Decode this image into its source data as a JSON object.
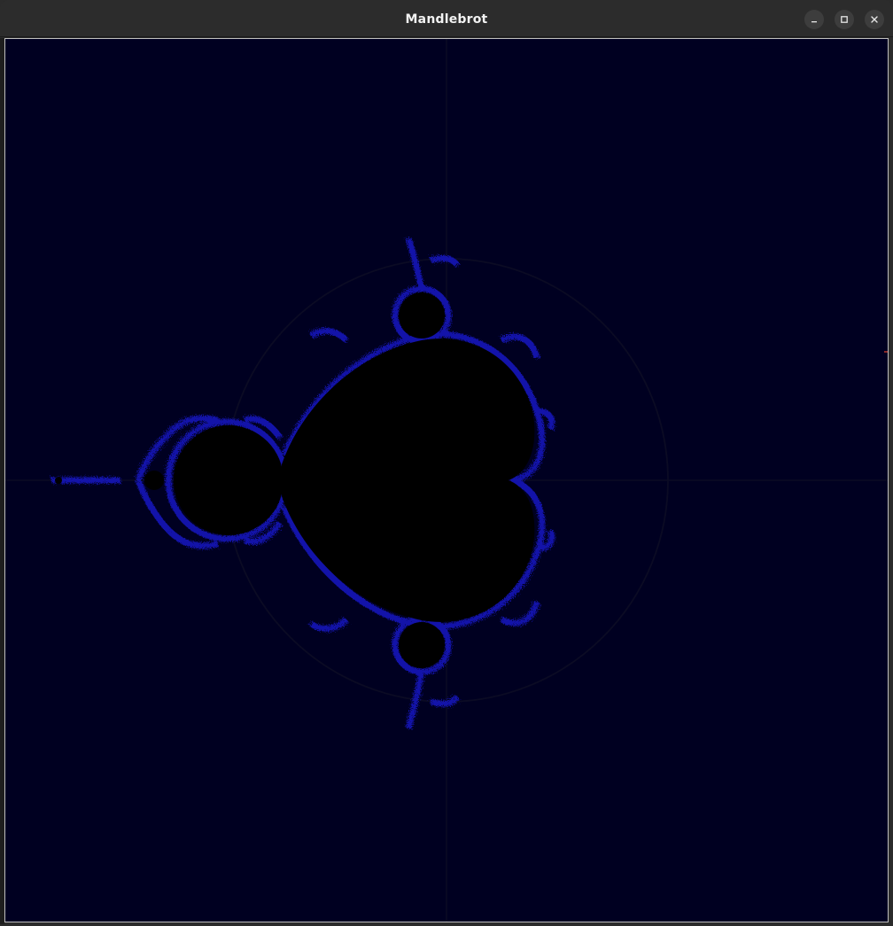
{
  "window": {
    "title": "Mandlebrot"
  },
  "controls": {
    "minimize_icon": "minimize-icon",
    "maximize_icon": "maximize-icon",
    "close_icon": "close-icon"
  },
  "colors": {
    "background": "#000021",
    "set": "#000000",
    "fringe": "#1a1acc",
    "axis": "#0d0d2a",
    "titlebar": "#2c2c2c",
    "title_text": "#f2f2f2"
  }
}
